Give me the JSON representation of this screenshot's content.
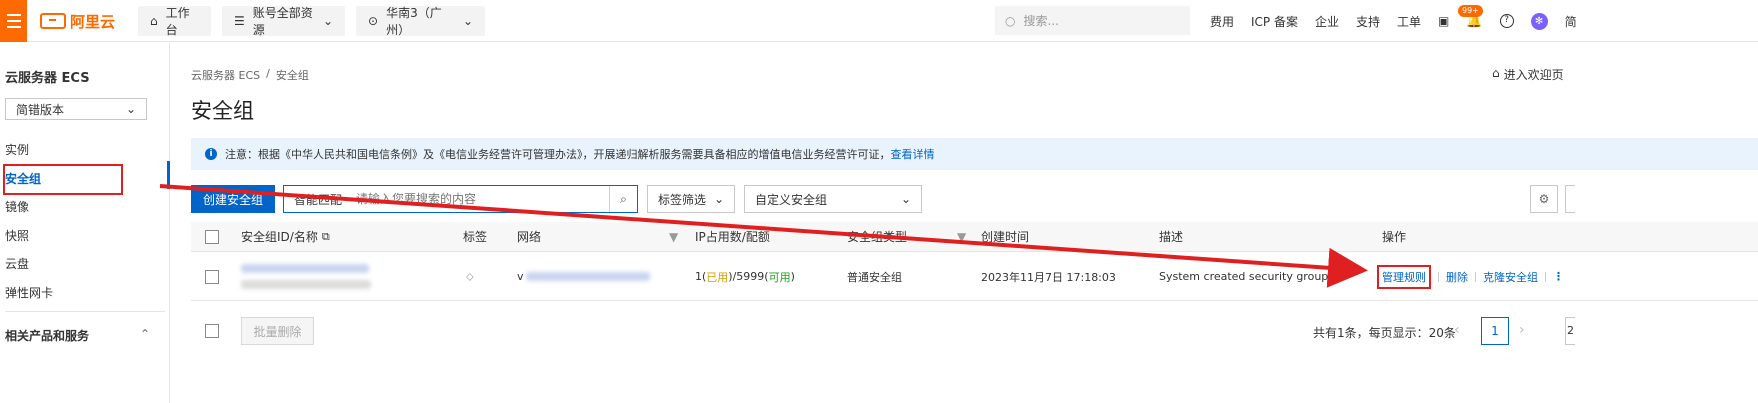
{
  "colors": {
    "brand": "#ff6a00",
    "primary": "#0064c8",
    "annotation": "#e02020",
    "notice_bg": "#e9f3fd"
  },
  "topbar": {
    "logo_text": "阿里云",
    "workbench": "工作台",
    "resources": "账号全部资源",
    "region": "华南3（广州）",
    "search_placeholder": "搜索...",
    "links": [
      "费用",
      "ICP 备案",
      "企业",
      "支持",
      "工单"
    ],
    "badge": "99+",
    "trailing": "简",
    "icons": [
      "terminal-icon",
      "bell-icon",
      "help-icon",
      "avatar"
    ]
  },
  "sidebar": {
    "title": "云服务器 ECS",
    "version_select": "简错版本",
    "items": [
      "实例",
      "安全组",
      "镜像",
      "快照",
      "云盘",
      "弹性网卡"
    ],
    "active_index": 1,
    "section": "相关产品和服务"
  },
  "breadcrumb": {
    "root": "云服务器 ECS",
    "sep": "/",
    "current": "安全组"
  },
  "welcome_link": "进入欢迎页",
  "page_title": "安全组",
  "notice": {
    "text": "注意：根据《中华人民共和国电信条例》及《电信业务经营许可管理办法》，开展递归解析服务需要具备相应的增值电信业务经营许可证，",
    "link": "查看详情"
  },
  "toolbar": {
    "create": "创建安全组",
    "search_type": "智能匹配",
    "search_placeholder": "请输入您要搜索的内容",
    "tag_filter": "标签筛选",
    "custom_group": "自定义安全组"
  },
  "table": {
    "headers": [
      "安全组ID/名称",
      "标签",
      "网络",
      "IP占用数/配额",
      "安全组类型",
      "创建时间",
      "描述",
      "操作"
    ],
    "rows": [
      {
        "ip_used": "1",
        "ip_used_label": "已用",
        "ip_quota": "5999",
        "ip_quota_label": "可用",
        "type": "普通安全组",
        "created": "2023年11月7日 17:18:03",
        "description": "System created security group.",
        "ops": [
          "管理规则",
          "删除",
          "克隆安全组"
        ]
      }
    ]
  },
  "footer": {
    "batch_delete": "批量删除",
    "summary": "共有1条，每页显示：20条",
    "current_page": "1"
  }
}
